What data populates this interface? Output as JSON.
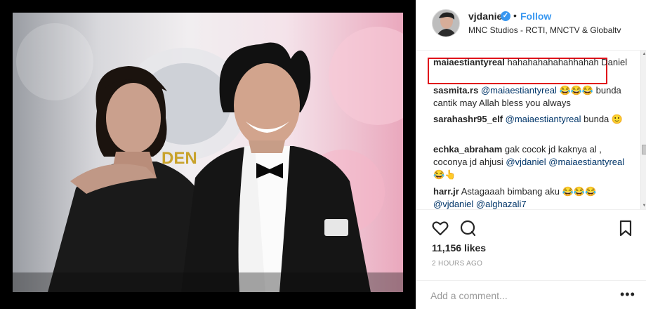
{
  "post": {
    "photo_alt": "Two men in black suits posing together",
    "photo_text": "DEN"
  },
  "header": {
    "username": "vjdaniel",
    "verified_icon": "verified-badge-icon",
    "separator": "•",
    "follow_label": "Follow",
    "location": "MNC Studios - RCTI, MNCTV & Globaltv"
  },
  "comments": [
    {
      "user": "maiaestiantyreal",
      "text": "hahahahahahahhahah Daniel"
    },
    {
      "user": "sasmita.rs",
      "mention": "@maiaestiantyreal",
      "emoji": "😂😂😂",
      "text": "bunda cantik may Allah bless you always"
    },
    {
      "user": "sarahashr95_elf",
      "mention": "@maiaestiantyreal",
      "text": "bunda",
      "emoji": "🙂"
    },
    {
      "user": "echka_abraham",
      "text": "gak cocok jd kaknya al , coconya jd ahjusi",
      "mention": "@vjdaniel",
      "mention2": "@maiaestiantyreal",
      "emoji": "😂👆"
    },
    {
      "user": "harr.jr",
      "text": "Astagaaah bimbang aku",
      "emoji": "😂😂😂",
      "mention": "@vjdaniel",
      "mention2": "@alghazali7"
    }
  ],
  "stats": {
    "likes": "11,156 likes",
    "time": "2 HOURS AGO"
  },
  "composer": {
    "placeholder": "Add a comment...",
    "more": "•••"
  },
  "icons": {
    "like": "heart-icon",
    "comment": "comment-icon",
    "save": "bookmark-icon",
    "more": "more-options-icon"
  },
  "colors": {
    "link": "#3897f0",
    "mention": "#003569",
    "highlight_border": "#e0101a",
    "muted": "#999999"
  }
}
